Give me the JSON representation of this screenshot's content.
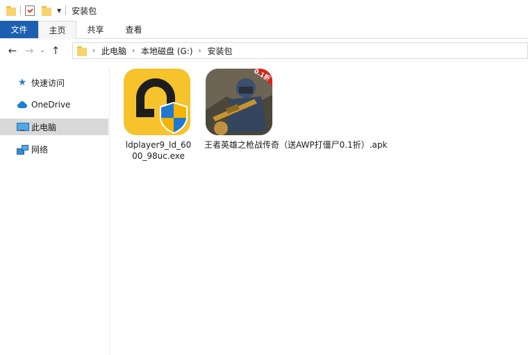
{
  "window": {
    "title": "安装包"
  },
  "ribbon": {
    "tabs": [
      {
        "label": "文件"
      },
      {
        "label": "主页"
      },
      {
        "label": "共享"
      },
      {
        "label": "查看"
      }
    ]
  },
  "address": {
    "crumbs": [
      "此电脑",
      "本地磁盘 (G:)",
      "安装包"
    ]
  },
  "sidebar": {
    "items": [
      {
        "label": "快速访问",
        "icon": "quick-access-star-icon"
      },
      {
        "label": "OneDrive",
        "icon": "onedrive-cloud-icon"
      },
      {
        "label": "此电脑",
        "icon": "this-pc-icon",
        "selected": true
      },
      {
        "label": "网络",
        "icon": "network-icon"
      }
    ]
  },
  "files": [
    {
      "name_line1": "ldplayer9_ld_60",
      "name_line2": "00_98uc.exe",
      "icon": "ldplayer-installer-icon"
    },
    {
      "name": "王者英雄之枪战传奇（送AWP打僵尸0.1折）.apk",
      "icon": "game-apk-icon",
      "badge": "0.1折"
    }
  ],
  "colors": {
    "file_tab": "#1c5fb0",
    "selected_nav": "#d9d9d9",
    "ld_yellow": "#f6c32c"
  }
}
